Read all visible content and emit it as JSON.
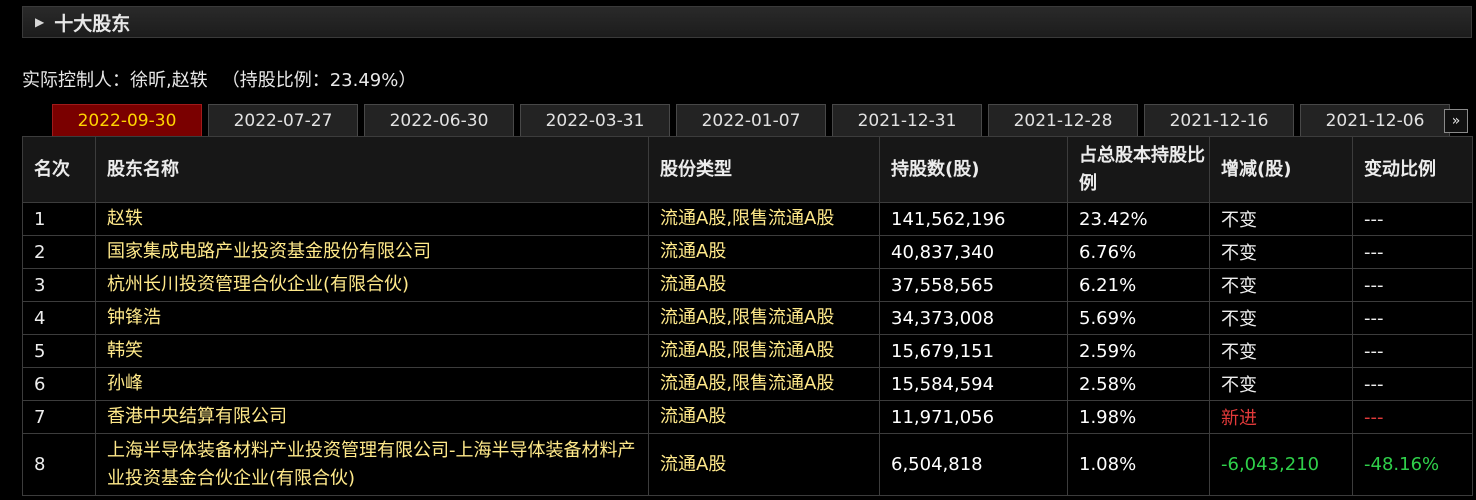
{
  "section": {
    "title": "十大股东"
  },
  "controller": {
    "label": "实际控制人：",
    "names": "徐昕,赵轶",
    "ratio": "（持股比例：23.49%）"
  },
  "tabs": [
    {
      "label": "2022-09-30",
      "active": true
    },
    {
      "label": "2022-07-27"
    },
    {
      "label": "2022-06-30"
    },
    {
      "label": "2022-03-31"
    },
    {
      "label": "2022-01-07"
    },
    {
      "label": "2021-12-31"
    },
    {
      "label": "2021-12-28"
    },
    {
      "label": "2021-12-16"
    },
    {
      "label": "2021-12-06"
    }
  ],
  "tab_more": "»",
  "columns": [
    "名次",
    "股东名称",
    "股份类型",
    "持股数(股)",
    "占总股本持股比例",
    "增减(股)",
    "变动比例"
  ],
  "rows": [
    {
      "rank": "1",
      "name": "赵轶",
      "type": "流通A股,限售流通A股",
      "shares": "141,562,196",
      "ratio": "23.42%",
      "change": "不变",
      "change_ratio": "---"
    },
    {
      "rank": "2",
      "name": "国家集成电路产业投资基金股份有限公司",
      "type": "流通A股",
      "shares": "40,837,340",
      "ratio": "6.76%",
      "change": "不变",
      "change_ratio": "---"
    },
    {
      "rank": "3",
      "name": "杭州长川投资管理合伙企业(有限合伙)",
      "type": "流通A股",
      "shares": "37,558,565",
      "ratio": "6.21%",
      "change": "不变",
      "change_ratio": "---"
    },
    {
      "rank": "4",
      "name": "钟锋浩",
      "type": "流通A股,限售流通A股",
      "shares": "34,373,008",
      "ratio": "5.69%",
      "change": "不变",
      "change_ratio": "---"
    },
    {
      "rank": "5",
      "name": "韩笑",
      "type": "流通A股,限售流通A股",
      "shares": "15,679,151",
      "ratio": "2.59%",
      "change": "不变",
      "change_ratio": "---"
    },
    {
      "rank": "6",
      "name": "孙峰",
      "type": "流通A股,限售流通A股",
      "shares": "15,584,594",
      "ratio": "2.58%",
      "change": "不变",
      "change_ratio": "---"
    },
    {
      "rank": "7",
      "name": "香港中央结算有限公司",
      "type": "流通A股",
      "shares": "11,971,056",
      "ratio": "1.98%",
      "change": "新进",
      "change_ratio": "---"
    },
    {
      "rank": "8",
      "name": "上海半导体装备材料产业投资管理有限公司-上海半导体装备材料产业投资基金合伙企业(有限合伙)",
      "type": "流通A股",
      "shares": "6,504,818",
      "ratio": "1.08%",
      "change": "-6,043,210",
      "change_ratio": "-48.16%"
    }
  ],
  "colors": {
    "active_tab_bg": "#7a0000",
    "active_tab_text": "#ffd400",
    "name_text": "#ffe98a",
    "new_entry": "#e23a3a",
    "decrease": "#2fd04a"
  }
}
